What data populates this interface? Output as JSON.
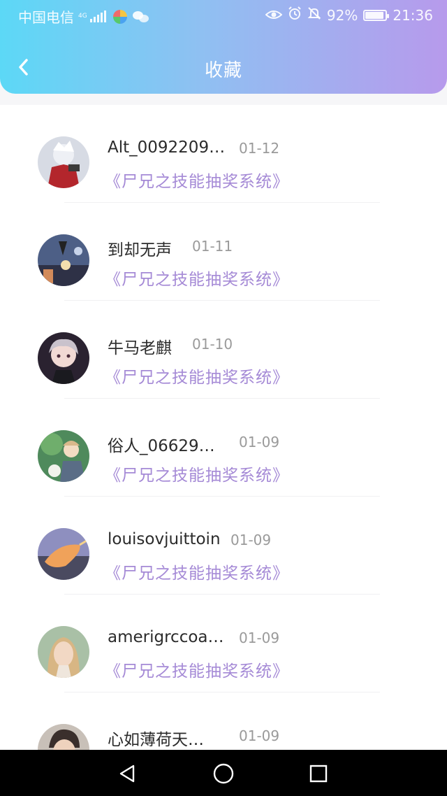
{
  "status_bar": {
    "carrier": "中国电信",
    "network_type": "4G",
    "battery_percent": "92%",
    "time": "21:36",
    "icons": [
      "signal-icon",
      "app-icon",
      "wechat-icon",
      "eye-icon",
      "alarm-icon",
      "mute-bell-icon",
      "battery-icon"
    ]
  },
  "header": {
    "title": "收藏",
    "back_icon": "chevron-left-icon",
    "gradient": [
      "#5cd8f6",
      "#b79aec"
    ]
  },
  "favorites": [
    {
      "name": "Alt_0092209…",
      "date": "01-12",
      "book": "《尸兄之技能抽奖系统》"
    },
    {
      "name": "到却无声",
      "date": "01-11",
      "book": "《尸兄之技能抽奖系统》"
    },
    {
      "name": "牛马老麒",
      "date": "01-10",
      "book": "《尸兄之技能抽奖系统》"
    },
    {
      "name": "俗人_06629…",
      "date": "01-09",
      "book": "《尸兄之技能抽奖系统》"
    },
    {
      "name": "louisovjuittoin",
      "date": "01-09",
      "book": "《尸兄之技能抽奖系统》"
    },
    {
      "name": "amerigrccoa…",
      "date": "01-09",
      "book": "《尸兄之技能抽奖系统》"
    },
    {
      "name": "心如薄荷天…",
      "date": "01-09",
      "book": ""
    }
  ],
  "colors": {
    "book_title": "#a58ad6",
    "name": "#2b2b2b",
    "date": "#9a9a9a"
  },
  "system_nav": {
    "buttons": [
      "back-triangle-icon",
      "home-circle-icon",
      "recents-square-icon"
    ]
  }
}
